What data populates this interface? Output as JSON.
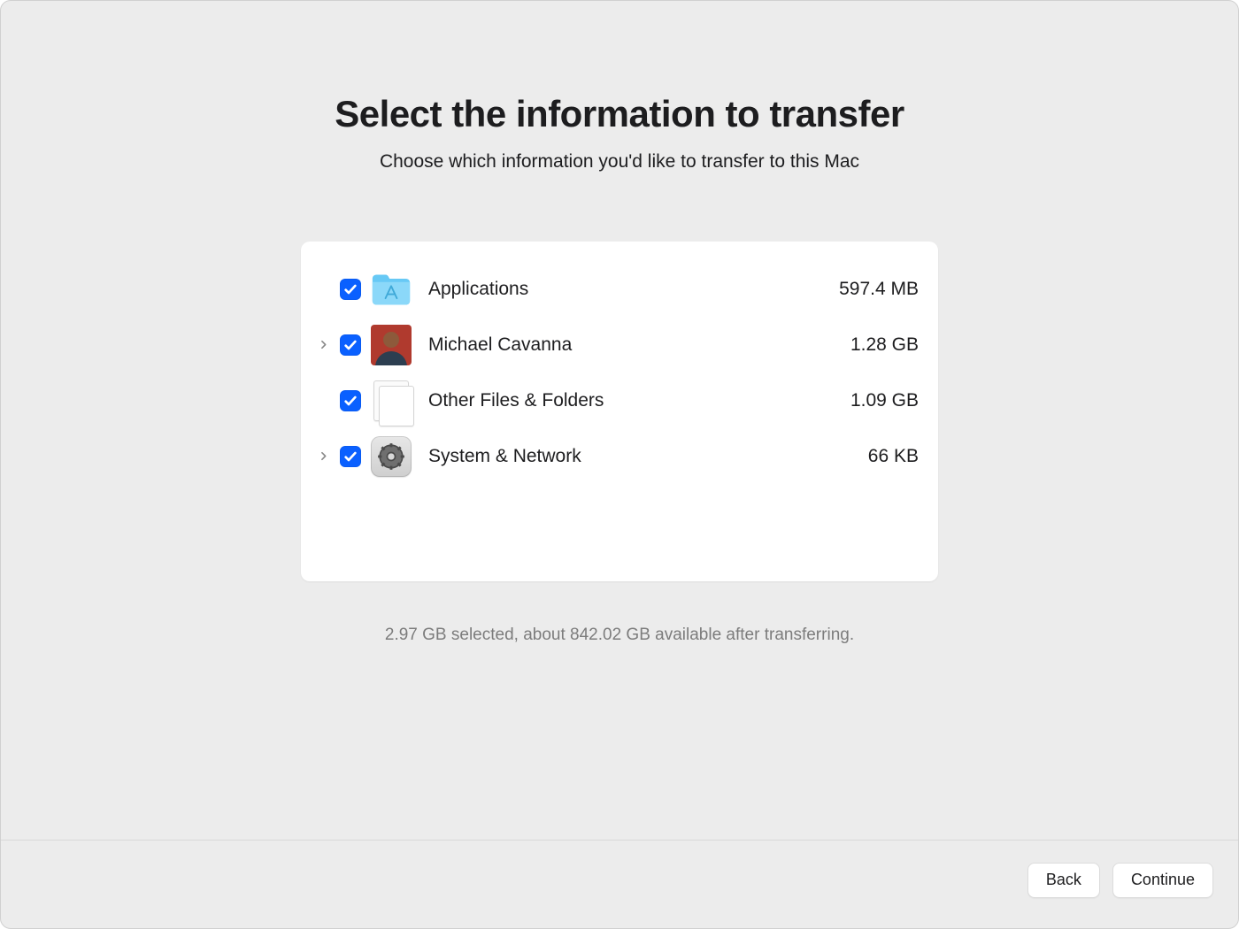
{
  "header": {
    "title": "Select the information to transfer",
    "subtitle": "Choose which information you'd like to transfer to this Mac"
  },
  "items": [
    {
      "label": "Applications",
      "size": "597.4 MB",
      "checked": true,
      "expandable": false,
      "icon": "apps-folder"
    },
    {
      "label": "Michael Cavanna",
      "size": "1.28 GB",
      "checked": true,
      "expandable": true,
      "icon": "avatar"
    },
    {
      "label": "Other Files & Folders",
      "size": "1.09 GB",
      "checked": true,
      "expandable": false,
      "icon": "document"
    },
    {
      "label": "System & Network",
      "size": "66 KB",
      "checked": true,
      "expandable": true,
      "icon": "settings"
    }
  ],
  "summary": "2.97 GB selected, about 842.02 GB available after transferring.",
  "footer": {
    "back_label": "Back",
    "continue_label": "Continue"
  }
}
